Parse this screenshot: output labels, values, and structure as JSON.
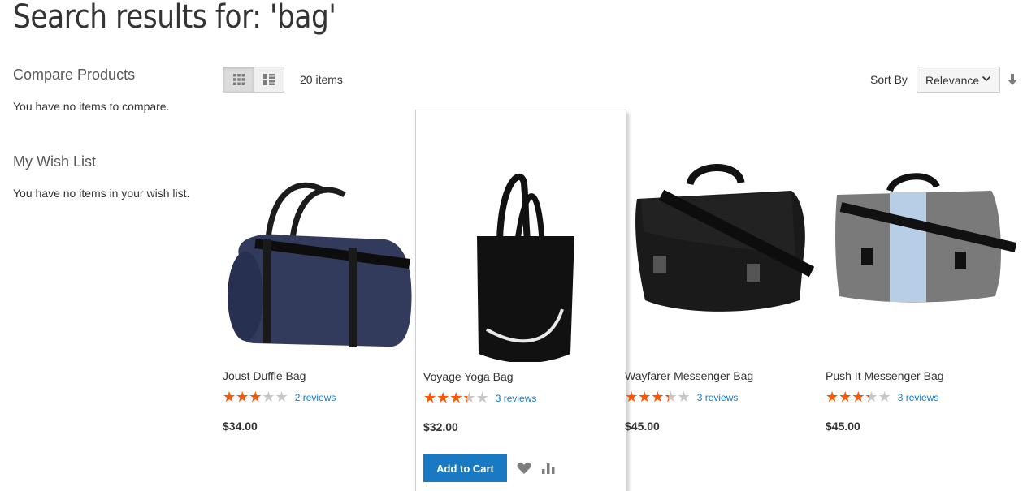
{
  "page": {
    "title": "Search results for: 'bag'"
  },
  "sidebar": {
    "compare_title": "Compare Products",
    "compare_empty": "You have no items to compare.",
    "wishlist_title": "My Wish List",
    "wishlist_empty": "You have no items in your wish list."
  },
  "toolbar": {
    "amount": "20 items",
    "sort_label": "Sort By",
    "sort_value": "Relevance",
    "view_mode": "grid"
  },
  "products": [
    {
      "name": "Joust Duffle Bag",
      "rating_percent": 60,
      "reviews": "2 reviews",
      "price": "$34.00"
    },
    {
      "name": "Voyage Yoga Bag",
      "rating_percent": 67,
      "reviews": "3 reviews",
      "price": "$32.00",
      "add_to_cart": "Add to Cart"
    },
    {
      "name": "Wayfarer Messenger Bag",
      "rating_percent": 67,
      "reviews": "3 reviews",
      "price": "$45.00"
    },
    {
      "name": "Push It Messenger Bag",
      "rating_percent": 67,
      "reviews": "3 reviews",
      "price": "$45.00"
    }
  ],
  "colors": {
    "accent": "#1979c3",
    "star": "#ff5501"
  }
}
